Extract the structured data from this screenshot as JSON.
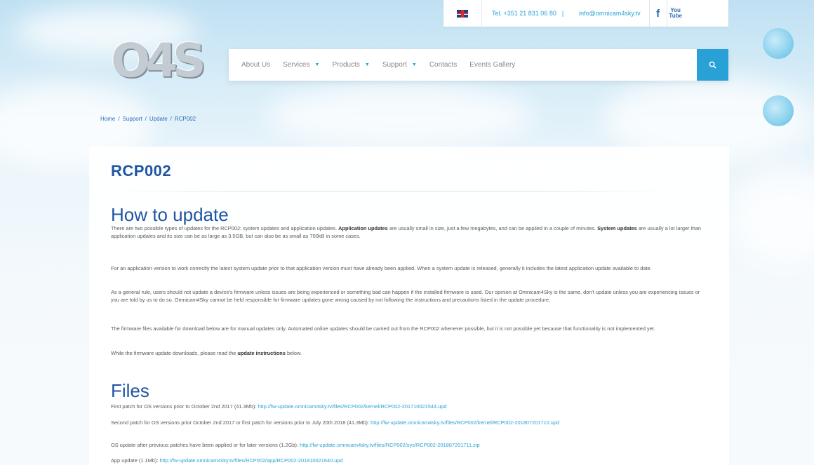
{
  "topbar": {
    "phone": "Tel. +351 21 831 06 80",
    "separator": "|",
    "email": "info@omnicam4sky.tv",
    "facebook_glyph": "f",
    "youtube_glyph_top": "You",
    "youtube_glyph_bottom": "Tube"
  },
  "logo": {
    "text": "O4S"
  },
  "nav": {
    "items": [
      {
        "label": "About Us",
        "dropdown": false
      },
      {
        "label": "Services",
        "dropdown": true
      },
      {
        "label": "Products",
        "dropdown": true
      },
      {
        "label": "Support",
        "dropdown": true
      },
      {
        "label": "Contacts",
        "dropdown": false
      },
      {
        "label": "Events Gallery",
        "dropdown": false
      }
    ],
    "caret": "▼",
    "search_icon": "search-icon",
    "accent_color": "#2aa1d6"
  },
  "breadcrumb": {
    "items": [
      "Home",
      "Support",
      "Update",
      "RCP002"
    ],
    "sep": "/"
  },
  "page": {
    "title": "RCP002",
    "how_heading": "How to update",
    "p1_a": "There are two possible types of updates for the RCP002: system updates and application updates. ",
    "p1_b": "Application updates",
    "p1_c": " are usually small in size, just a few megabytes, and can be applied in a couple of minutes. ",
    "p1_d": "System updates",
    "p1_e": " are usually a lot larger than application updates and its size can be as large as 3.5GB, but can also be as small as 700kB in some cases.",
    "p2": "For an application version to work correctly the latest system update prior to that application version must have already been applied. When a system update is released, generally it includes the latest application update available to date.",
    "p3": "As a general rule, users should not update a device's firmware unless issues are being experienced or something bad can happen if the installed firmware is used. Our opinion at Omnicam4Sky is the same, don't update unless you are experiencing issues or you are told by us to do so. Omnicam4Sky cannot be held responsible for firmware updates gone wrong caused by not following the instructions and precautions listed in the update procedure.",
    "p4": "The firmware files available for download below are for manual updates only. Automated online updates should be carried out from the RCP002 whenever possible, but it is not possible yet because that functionality is not implemented yet.",
    "p5_a": "While the firmware update downloads, please read the ",
    "p5_b": "update instructions",
    "p5_c": " below.",
    "files_heading": "Files",
    "files": [
      {
        "label": "First patch for OS versions prior to October 2nd 2017 (41.3Mb): ",
        "url": "http://fw-update.omnicam4sky.tv/files/RCP002/kernel/RCP002-201710021544.upd"
      },
      {
        "label": "Second patch for OS versions prior October 2nd 2017 or first patch for versions prior to July 20th 2018 (41.3Mb): ",
        "url": "http://fw-update.omnicam4sky.tv/files/RCP002/kernel/RCP002-201807201710.upd"
      },
      {
        "label": "OS update after previous patches have been applied or for later versions (1.2Gb): ",
        "url": "http://fw-update.omnicam4sky.tv/files/RCP002/sys/RCP002-201807201711.zip"
      },
      {
        "label": "App update (1.1Mb): ",
        "url": "http://fw-update.omnicam4sky.tv/files/RCP002/app/RCP002-201810021640.upd"
      }
    ]
  }
}
